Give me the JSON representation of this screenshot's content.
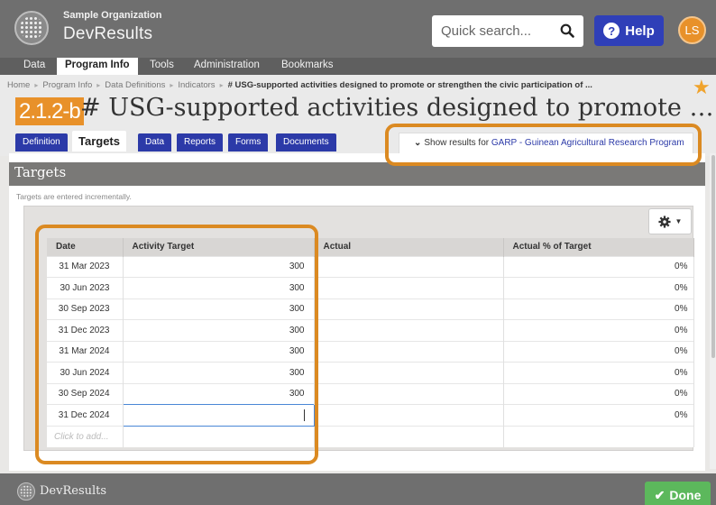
{
  "header": {
    "org_name": "Sample Organization",
    "app_name": "DevResults",
    "search_placeholder": "Quick search...",
    "help_label": "Help",
    "avatar_initials": "LS"
  },
  "nav": {
    "items": [
      "Data",
      "Program Info",
      "Tools",
      "Administration",
      "Bookmarks"
    ],
    "active": "Program Info"
  },
  "breadcrumb": {
    "items": [
      "Home",
      "Program Info",
      "Data Definitions",
      "Indicators"
    ],
    "current": "# USG-supported activities designed to promote or strengthen the civic participation of ..."
  },
  "indicator": {
    "code": "2.1.2-b",
    "title": "# USG-supported activities designed to promote or strengthen the civic participation of women"
  },
  "tabs": {
    "items": [
      "Definition",
      "Targets",
      "Data",
      "Reports",
      "Forms",
      "Documents"
    ],
    "active": "Targets"
  },
  "results_toggle": {
    "prefix": "Show results for",
    "link": "GARP - Guinean Agricultural Research Program"
  },
  "panel": {
    "title": "Targets",
    "note": "Targets are entered incrementally."
  },
  "grid": {
    "columns": [
      "Date",
      "Activity Target",
      "Actual",
      "Actual % of Target"
    ],
    "rows": [
      {
        "date": "31 Mar 2023",
        "target": "300",
        "actual": "",
        "pct": "0%"
      },
      {
        "date": "30 Jun 2023",
        "target": "300",
        "actual": "",
        "pct": "0%"
      },
      {
        "date": "30 Sep 2023",
        "target": "300",
        "actual": "",
        "pct": "0%"
      },
      {
        "date": "31 Dec 2023",
        "target": "300",
        "actual": "",
        "pct": "0%"
      },
      {
        "date": "31 Mar 2024",
        "target": "300",
        "actual": "",
        "pct": "0%"
      },
      {
        "date": "30 Jun 2024",
        "target": "300",
        "actual": "",
        "pct": "0%"
      },
      {
        "date": "30 Sep 2024",
        "target": "300",
        "actual": "",
        "pct": "0%"
      },
      {
        "date": "31 Dec 2024",
        "target": "",
        "actual": "",
        "pct": "0%"
      }
    ],
    "add_placeholder": "Click to add..."
  },
  "footer": {
    "brand": "DevResults",
    "done_label": "Done"
  },
  "colors": {
    "accent_orange": "#e8912a",
    "highlight_orange": "#db8a22",
    "primary_blue": "#2c3aa8",
    "done_green": "#5cb85c"
  }
}
